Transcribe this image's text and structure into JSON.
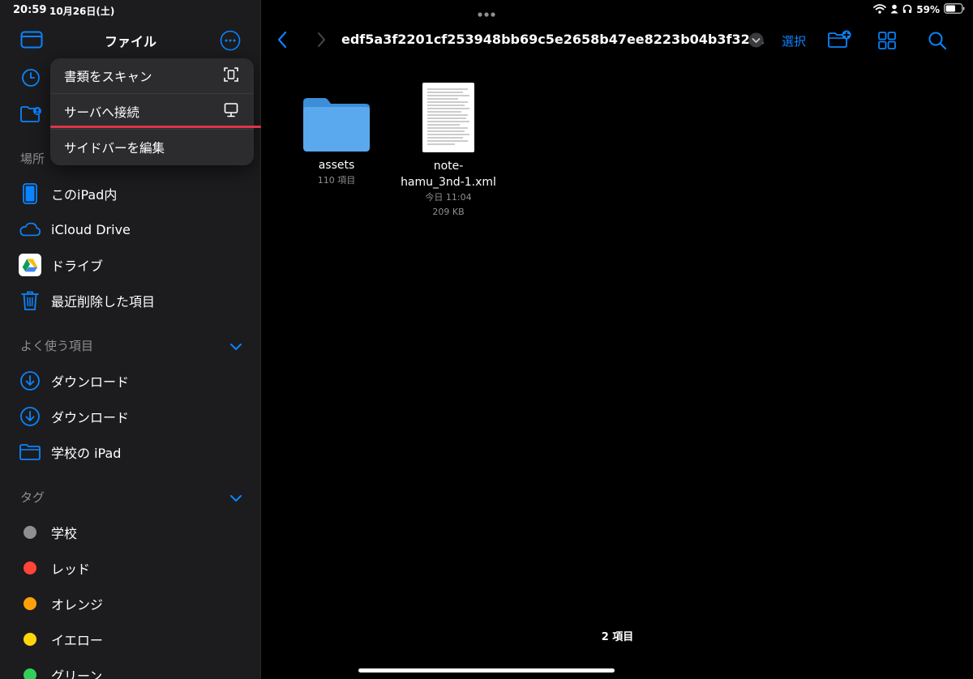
{
  "status": {
    "time": "20:59",
    "date": "10月26日(土)",
    "battery": "59%"
  },
  "sidebar": {
    "title": "ファイル",
    "sections": {
      "locations": "場所",
      "favorites": "よく使う項目",
      "tags": "タグ"
    },
    "locations": [
      {
        "label": "このiPad内"
      },
      {
        "label": "iCloud Drive"
      },
      {
        "label": "ドライブ"
      },
      {
        "label": "最近削除した項目"
      }
    ],
    "favorites": [
      {
        "label": "ダウンロード"
      },
      {
        "label": "ダウンロード"
      },
      {
        "label": "学校の iPad"
      }
    ],
    "tags": [
      {
        "label": "学校",
        "color": "#8e8e93"
      },
      {
        "label": "レッド",
        "color": "#ff453a"
      },
      {
        "label": "オレンジ",
        "color": "#ff9f0a"
      },
      {
        "label": "イエロー",
        "color": "#ffd60a"
      },
      {
        "label": "グリーン",
        "color": "#30d158"
      }
    ]
  },
  "menu": {
    "items": [
      {
        "label": "書類をスキャン",
        "icon": "scan-icon"
      },
      {
        "label": "サーバへ接続",
        "icon": "monitor-icon"
      },
      {
        "label": "サイドバーを編集"
      }
    ]
  },
  "toolbar": {
    "title": "edf5a3f2201cf253948bb69c5e2658b47ee8223b04b3f32...",
    "select_label": "選択"
  },
  "files": [
    {
      "name": "assets",
      "meta1": "110 項目"
    },
    {
      "name_line1": "note-",
      "name_line2": "hamu_3nd-1.xml",
      "meta1": "今日 11:04",
      "meta2": "209 KB"
    }
  ],
  "footer": {
    "count": "2 項目"
  },
  "colors": {
    "accent": "#0a84ff",
    "folder": "#5aa9ee",
    "highlight": "#e0334a"
  }
}
